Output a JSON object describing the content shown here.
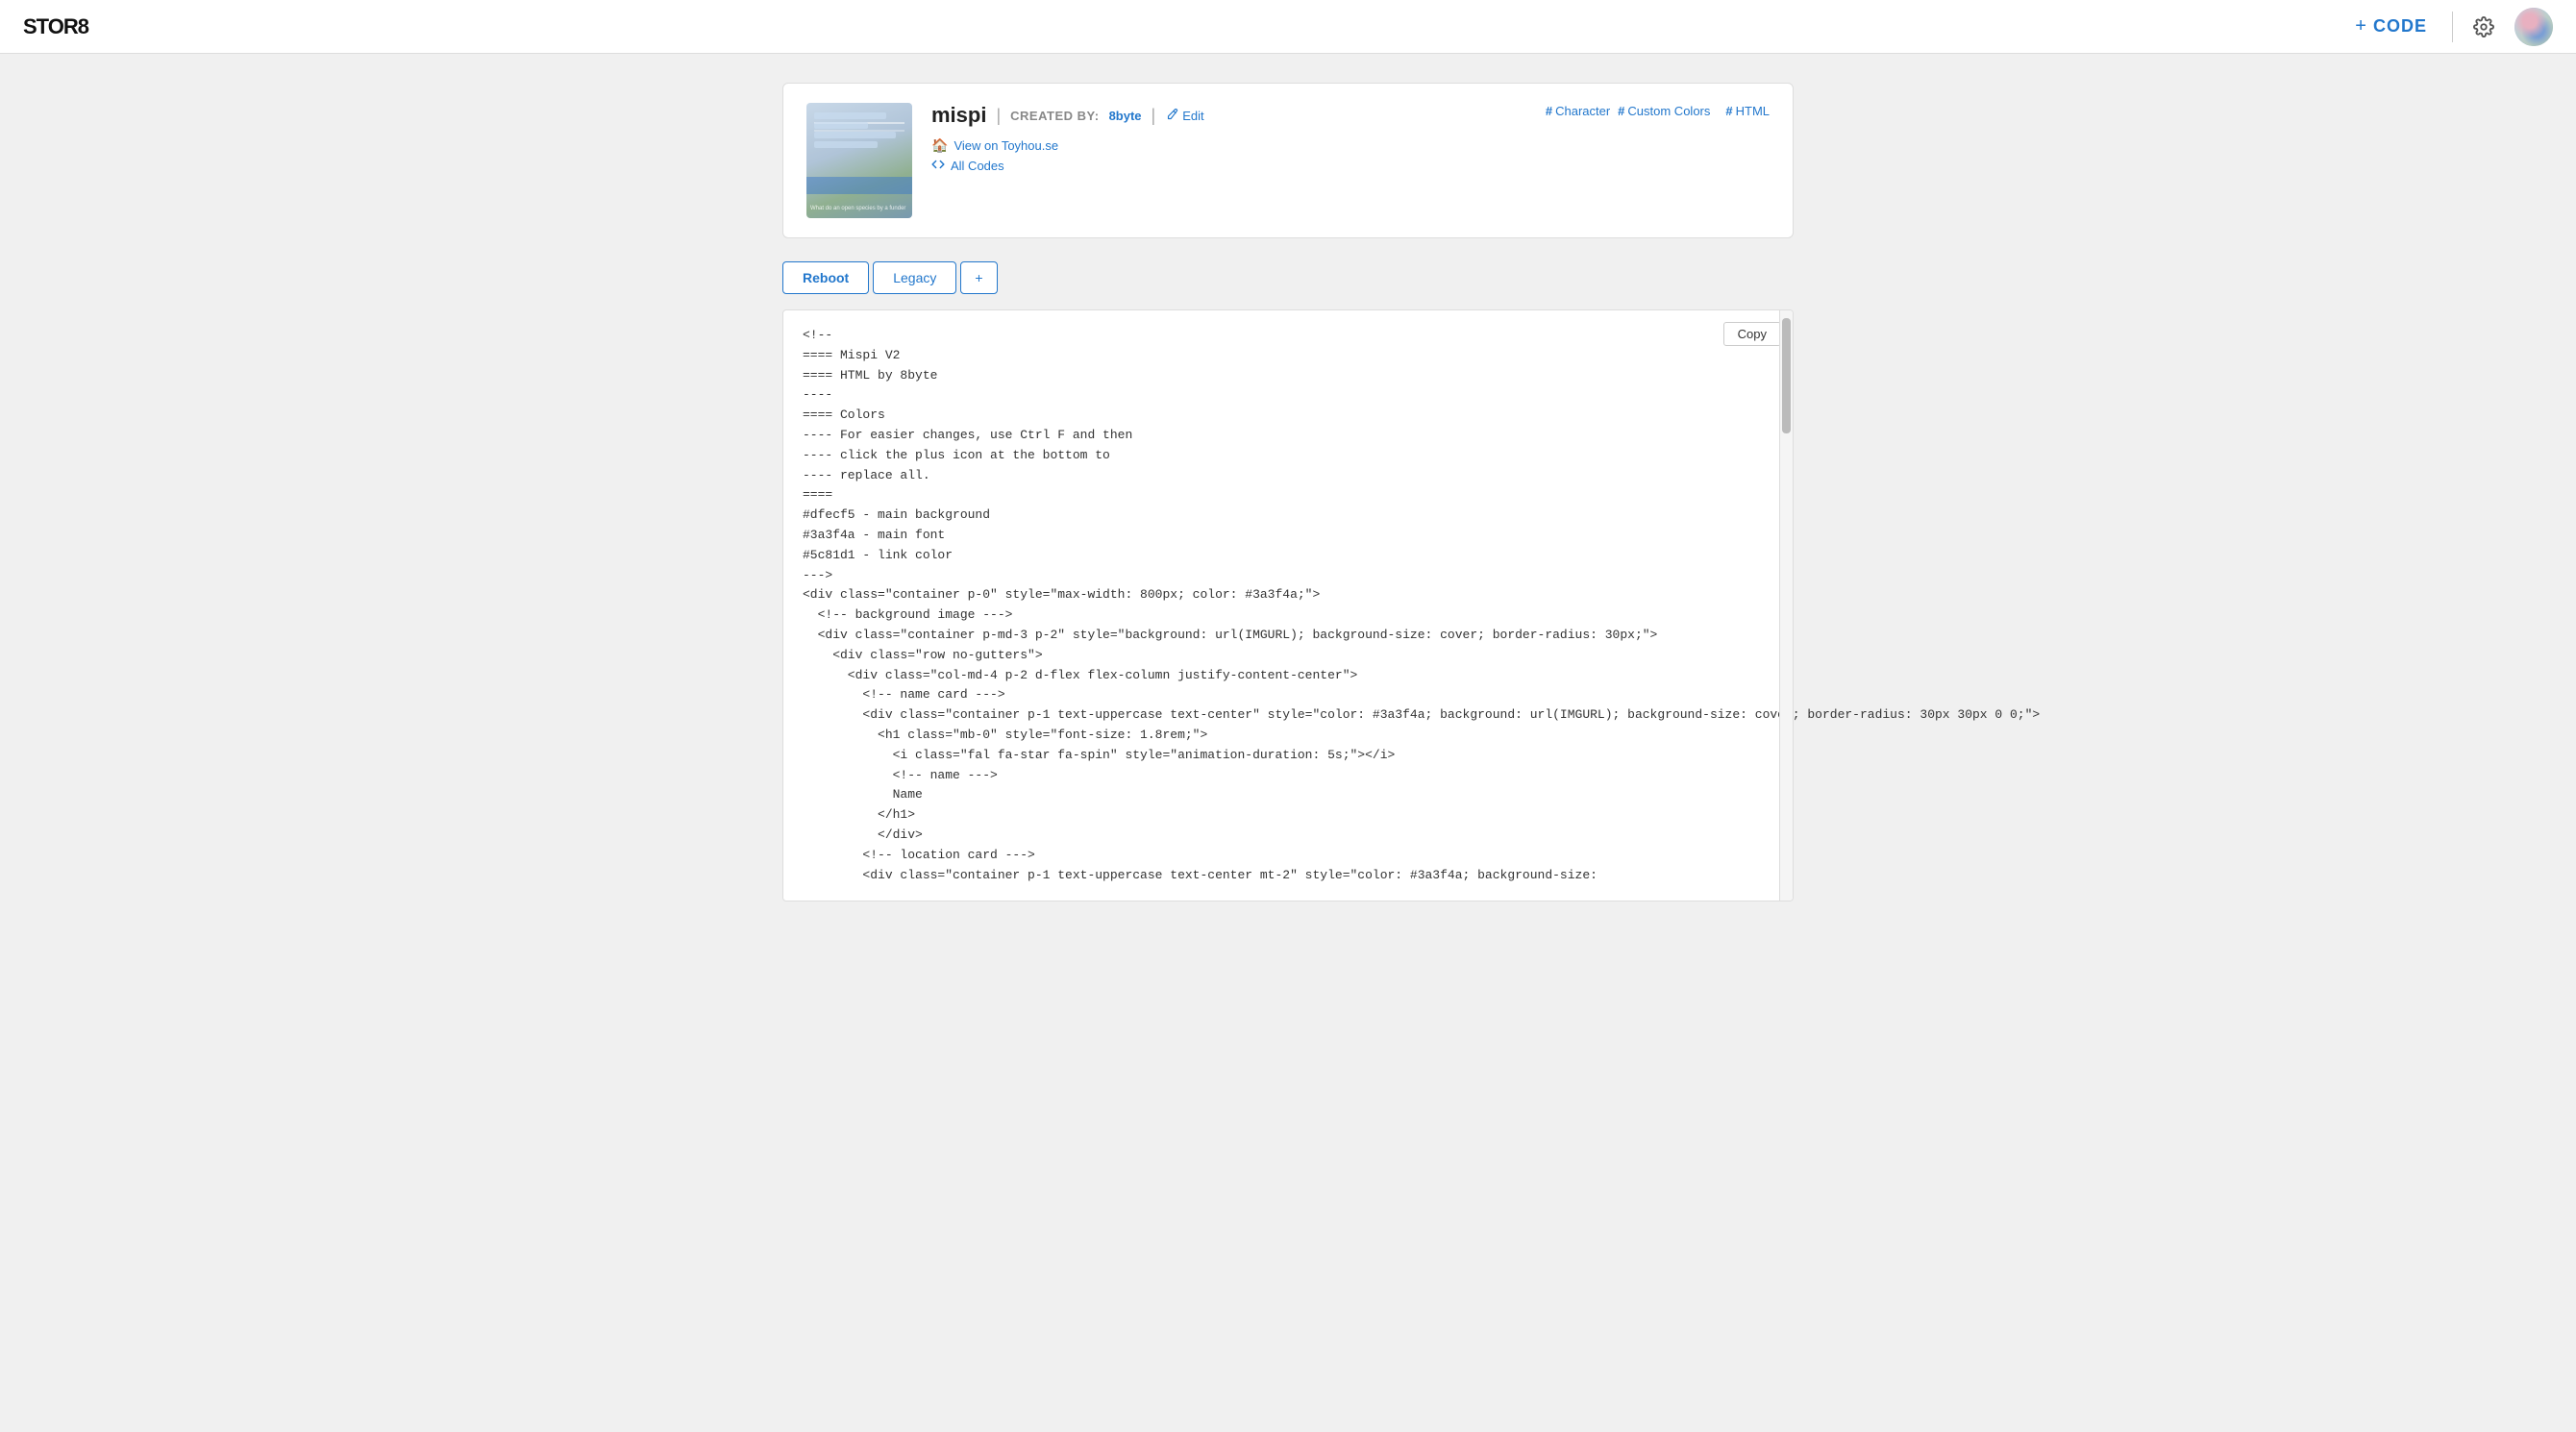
{
  "app": {
    "logo": "STOR8",
    "nav": {
      "plus": "+",
      "code_label": "CODE",
      "gear_title": "Settings"
    }
  },
  "character": {
    "thumbnail_alt": "mispi character thumbnail",
    "name": "mispi",
    "created_by_label": "CREATED BY:",
    "creator": "8byte",
    "edit_label": "Edit",
    "links": [
      {
        "icon": "house",
        "text": "View on Toyhou.se"
      },
      {
        "icon": "code",
        "text": "All Codes"
      }
    ],
    "tags": [
      {
        "hash": "#",
        "label": "Character"
      },
      {
        "hash": "#",
        "label": "Custom Colors"
      },
      {
        "hash": "#",
        "label": "HTML"
      }
    ]
  },
  "tabs": [
    {
      "label": "Reboot",
      "active": true
    },
    {
      "label": "Legacy",
      "active": false
    },
    {
      "label": "+",
      "active": false
    }
  ],
  "code_block": {
    "copy_label": "Copy",
    "content": "<!--\n==== Mispi V2\n==== HTML by 8byte\n----\n==== Colors\n---- For easier changes, use Ctrl F and then\n---- click the plus icon at the bottom to\n---- replace all.\n====\n#dfecf5 - main background\n#3a3f4a - main font\n#5c81d1 - link color\n--->\n<div class=\"container p-0\" style=\"max-width: 800px; color: #3a3f4a;\">\n  <!-- background image --->\n  <div class=\"container p-md-3 p-2\" style=\"background: url(IMGURL); background-size: cover; border-radius: 30px;\">\n    <div class=\"row no-gutters\">\n      <div class=\"col-md-4 p-2 d-flex flex-column justify-content-center\">\n        <!-- name card --->\n        <div class=\"container p-1 text-uppercase text-center\" style=\"color: #3a3f4a; background: url(IMGURL); background-size: cover; border-radius: 30px 30px 0 0;\">\n          <h1 class=\"mb-0\" style=\"font-size: 1.8rem;\">\n            <i class=\"fal fa-star fa-spin\" style=\"animation-duration: 5s;\"></i>\n            <!-- name --->\n            Name\n          </h1>\n          </div>\n        <!-- location card --->\n        <div class=\"container p-1 text-uppercase text-center mt-2\" style=\"color: #3a3f4a; background-size:"
  }
}
